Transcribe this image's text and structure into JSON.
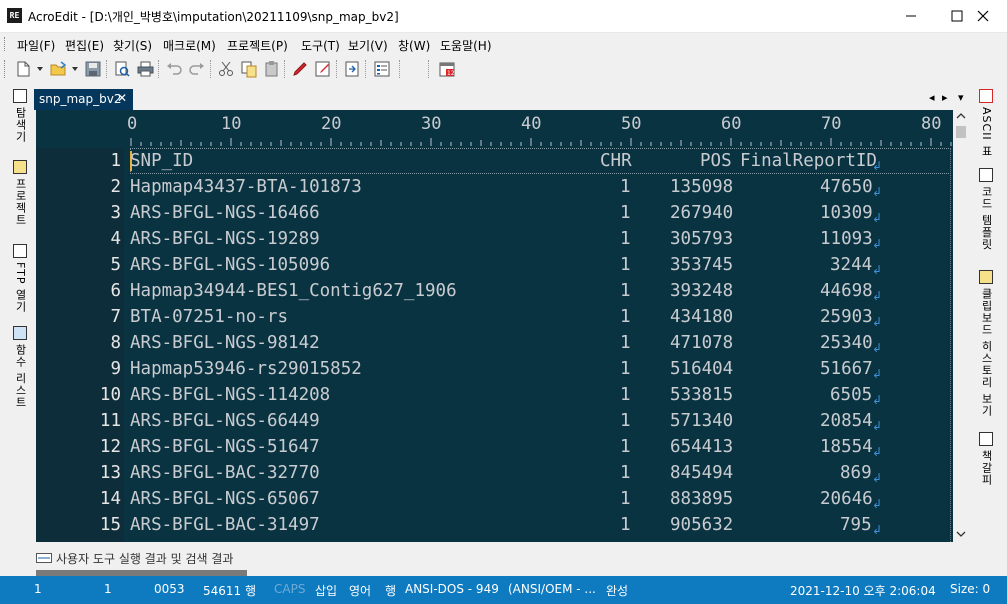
{
  "window": {
    "title": "AcroEdit - [D:\\개인_박병호\\imputation\\20211109\\snp_map_bv2]",
    "icon_text": "RE"
  },
  "menu": [
    "파일(F)",
    "편집(E)",
    "찾기(S)",
    "매크로(M)",
    "프로젝트(P)",
    "도구(T)",
    "보기(V)",
    "창(W)",
    "도움말(H)"
  ],
  "left_panel": {
    "tabs": [
      {
        "label": "탐색기",
        "icon": "explorer-icon"
      },
      {
        "label": "프로젝트",
        "icon": "project-icon"
      },
      {
        "label": "FTP 열기",
        "icon": "ftp-icon"
      },
      {
        "label": "함수 리스트",
        "icon": "function-list-icon"
      }
    ]
  },
  "right_panel": {
    "tabs": [
      {
        "label": "ASCII 표",
        "icon": "ascii-icon"
      },
      {
        "label": "코드 템플릿",
        "icon": "code-template-icon"
      },
      {
        "label": "클립보드 히스토리 보기",
        "icon": "clipboard-icon"
      },
      {
        "label": "책갈피",
        "icon": "bookmark-icon"
      }
    ]
  },
  "tab": {
    "label": "snp_map_bv2",
    "close": "✕"
  },
  "tab_nav": {
    "left": "◂",
    "right": "▸",
    "menu": "▾"
  },
  "ruler": {
    "marks": [
      "0",
      "10",
      "20",
      "30",
      "40",
      "50",
      "60",
      "70",
      "80"
    ]
  },
  "editor": {
    "lines": [
      {
        "n": "1",
        "id": "SNP_ID",
        "chr": "CHR",
        "pos": "POS",
        "frid": "FinalReportID"
      },
      {
        "n": "2",
        "id": "Hapmap43437-BTA-101873",
        "chr": "1",
        "pos": "135098",
        "frid": "47650"
      },
      {
        "n": "3",
        "id": "ARS-BFGL-NGS-16466",
        "chr": "1",
        "pos": "267940",
        "frid": "10309"
      },
      {
        "n": "4",
        "id": "ARS-BFGL-NGS-19289",
        "chr": "1",
        "pos": "305793",
        "frid": "11093"
      },
      {
        "n": "5",
        "id": "ARS-BFGL-NGS-105096",
        "chr": "1",
        "pos": "353745",
        "frid": "3244"
      },
      {
        "n": "6",
        "id": "Hapmap34944-BES1_Contig627_1906",
        "chr": "1",
        "pos": "393248",
        "frid": "44698"
      },
      {
        "n": "7",
        "id": "BTA-07251-no-rs",
        "chr": "1",
        "pos": "434180",
        "frid": "25903"
      },
      {
        "n": "8",
        "id": "ARS-BFGL-NGS-98142",
        "chr": "1",
        "pos": "471078",
        "frid": "25340"
      },
      {
        "n": "9",
        "id": "Hapmap53946-rs29015852",
        "chr": "1",
        "pos": "516404",
        "frid": "51667"
      },
      {
        "n": "10",
        "id": "ARS-BFGL-NGS-114208",
        "chr": "1",
        "pos": "533815",
        "frid": "6505"
      },
      {
        "n": "11",
        "id": "ARS-BFGL-NGS-66449",
        "chr": "1",
        "pos": "571340",
        "frid": "20854"
      },
      {
        "n": "12",
        "id": "ARS-BFGL-NGS-51647",
        "chr": "1",
        "pos": "654413",
        "frid": "18554"
      },
      {
        "n": "13",
        "id": "ARS-BFGL-BAC-32770",
        "chr": "1",
        "pos": "845494",
        "frid": "869"
      },
      {
        "n": "14",
        "id": "ARS-BFGL-NGS-65067",
        "chr": "1",
        "pos": "883895",
        "frid": "20646"
      },
      {
        "n": "15",
        "id": "ARS-BFGL-BAC-31497",
        "chr": "1",
        "pos": "905632",
        "frid": "795"
      }
    ]
  },
  "bottom_panel": {
    "label": "사용자 도구 실행 결과 및 검색 결과"
  },
  "status": {
    "line": "1",
    "col": "1",
    "char_code": "0053",
    "line_count": "54611 행",
    "caps": "CAPS",
    "insert": "삽입",
    "lang": "영어",
    "mode": "행",
    "encoding": "ANSI-DOS - 949",
    "encoding_desc": "(ANSI/OEM - ...",
    "state": "완성",
    "datetime": "2021-12-10 오후 2:06:04",
    "size": "Size: 0"
  },
  "colors": {
    "editor_bg": "#0a3342",
    "text": "#c8ccd0",
    "statusbar": "#0e7ac0",
    "tab_active": "#05375c",
    "eol_marker": "#3f8fd6"
  }
}
